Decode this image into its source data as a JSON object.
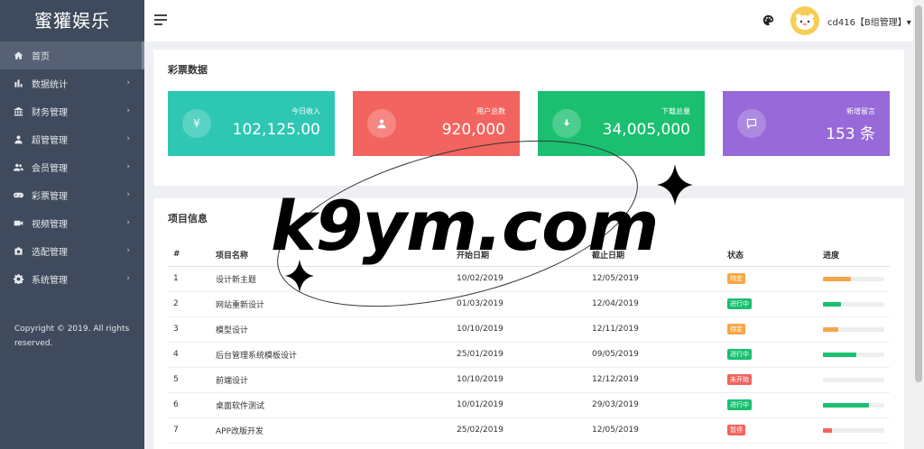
{
  "sidebar": {
    "brand": "蜜獾娱乐",
    "items": [
      {
        "label": "首页",
        "icon": "home-icon",
        "arrow": ""
      },
      {
        "label": "数据统计",
        "icon": "bar-chart-icon",
        "arrow": "›"
      },
      {
        "label": "财务管理",
        "icon": "bank-icon",
        "arrow": "›"
      },
      {
        "label": "超管管理",
        "icon": "user-icon",
        "arrow": "›"
      },
      {
        "label": "会员管理",
        "icon": "users-icon",
        "arrow": "›"
      },
      {
        "label": "彩票管理",
        "icon": "gamepad-icon",
        "arrow": "›"
      },
      {
        "label": "视频管理",
        "icon": "video-icon",
        "arrow": "›"
      },
      {
        "label": "选配管理",
        "icon": "camera-icon",
        "arrow": "›"
      },
      {
        "label": "系统管理",
        "icon": "gear-icon",
        "arrow": "›"
      }
    ],
    "copyright": "Copyright © 2019. All rights reserved."
  },
  "topbar": {
    "user_name": "cd416【B组管理】▾",
    "icons": [
      "menu-icon",
      "palette-icon",
      "avatar"
    ]
  },
  "stats_panel": {
    "title": "彩票数据",
    "cards": [
      {
        "icon": "yen-icon",
        "label": "今日收入",
        "value": "102,125.00",
        "color": "#2ec7b4"
      },
      {
        "icon": "user-icon",
        "label": "用户总数",
        "value": "920,000",
        "color": "#f2645f"
      },
      {
        "icon": "download-icon",
        "label": "下载总量",
        "value": "34,005,000",
        "color": "#1bbf70"
      },
      {
        "icon": "comment-icon",
        "label": "新增留言",
        "value": "153 条",
        "color": "#9769d9"
      }
    ]
  },
  "projects_panel": {
    "title": "项目信息",
    "headers": [
      "#",
      "项目名称",
      "开始日期",
      "截止日期",
      "状态",
      "进度"
    ],
    "rows": [
      {
        "idx": "1",
        "name": "设计新主题",
        "start": "10/02/2019",
        "end": "12/05/2019",
        "status": "待定",
        "status_color": "#f5a748",
        "progress": 0.45,
        "progress_color": "#f5a748"
      },
      {
        "idx": "2",
        "name": "网站重新设计",
        "start": "01/03/2019",
        "end": "12/04/2019",
        "status": "进行中",
        "status_color": "#1bbf70",
        "progress": 0.3,
        "progress_color": "#1bbf70"
      },
      {
        "idx": "3",
        "name": "模型设计",
        "start": "10/10/2019",
        "end": "12/11/2019",
        "status": "待定",
        "status_color": "#f5a748",
        "progress": 0.25,
        "progress_color": "#f5a748"
      },
      {
        "idx": "4",
        "name": "后台管理系统模板设计",
        "start": "25/01/2019",
        "end": "09/05/2019",
        "status": "进行中",
        "status_color": "#1bbf70",
        "progress": 0.55,
        "progress_color": "#1bbf70"
      },
      {
        "idx": "5",
        "name": "前端设计",
        "start": "10/10/2019",
        "end": "12/12/2019",
        "status": "未开始",
        "status_color": "#f2645f",
        "progress": 0,
        "progress_color": "#f2645f"
      },
      {
        "idx": "6",
        "name": "桌面软件测试",
        "start": "10/01/2019",
        "end": "29/03/2019",
        "status": "进行中",
        "status_color": "#1bbf70",
        "progress": 0.75,
        "progress_color": "#1bbf70"
      },
      {
        "idx": "7",
        "name": "APP改版开发",
        "start": "25/02/2019",
        "end": "12/05/2019",
        "status": "暂停",
        "status_color": "#f2645f",
        "progress": 0.15,
        "progress_color": "#f2645f"
      }
    ]
  },
  "watermark": {
    "text": "k9ym.com"
  }
}
